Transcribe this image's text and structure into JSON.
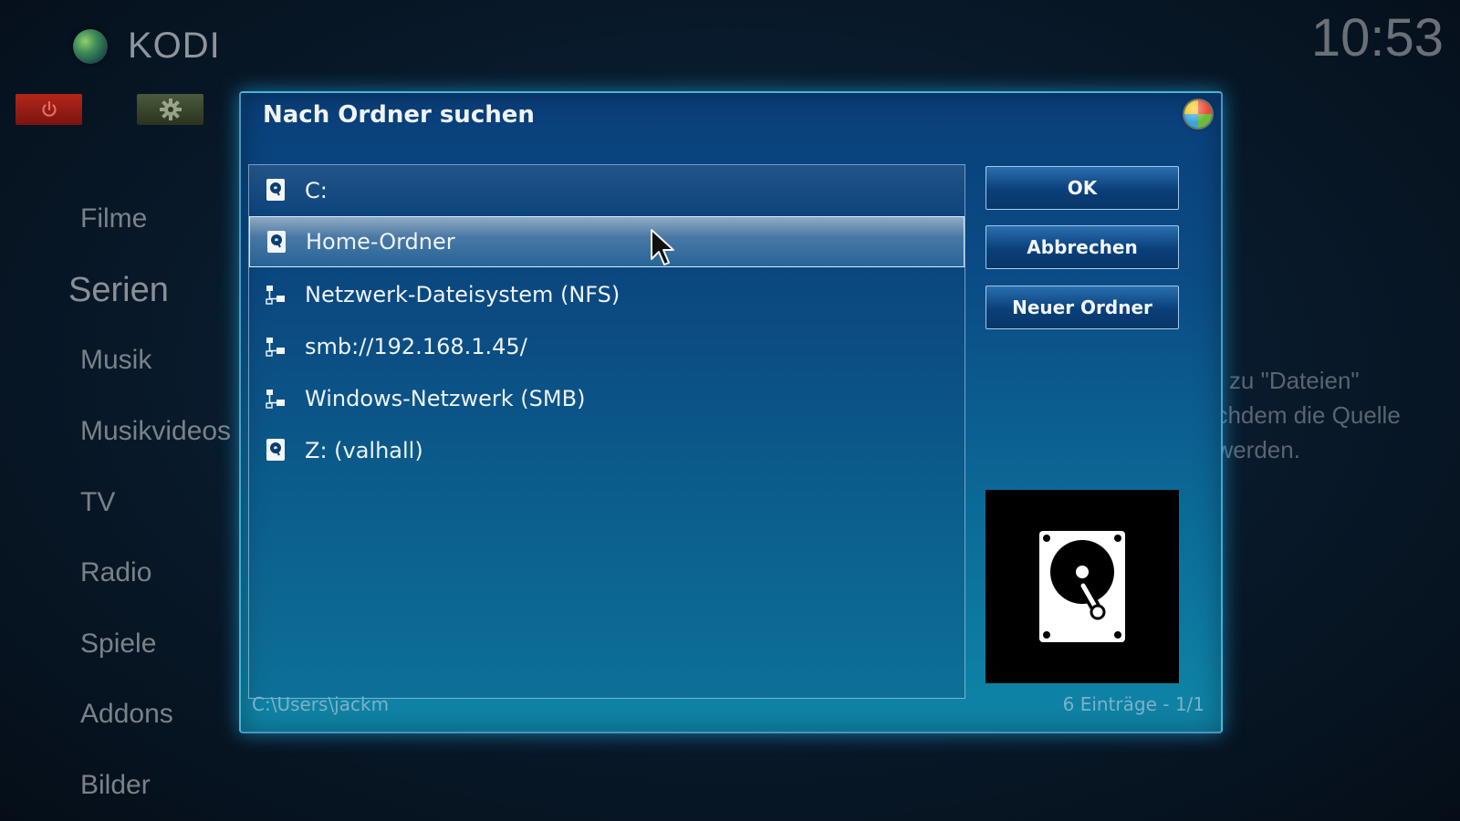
{
  "app": {
    "title": "KODI",
    "clock": "10:53"
  },
  "top_buttons": {
    "power_icon": "power-icon",
    "settings_icon": "gear-icon"
  },
  "sidebar": {
    "items": [
      {
        "label": "Filme"
      },
      {
        "label": "Serien"
      },
      {
        "label": "Musik"
      },
      {
        "label": "Musikvideos"
      },
      {
        "label": "TV"
      },
      {
        "label": "Radio"
      },
      {
        "label": "Spiele"
      },
      {
        "label": "Addons"
      },
      {
        "label": "Bilder"
      }
    ]
  },
  "background_hint": {
    "lines": [
      "n, zu \"Dateien\"",
      "achdem die Quelle",
      "t werden."
    ]
  },
  "dialog": {
    "title": "Nach Ordner suchen",
    "items": [
      {
        "label": "C:",
        "icon": "harddisk-icon"
      },
      {
        "label": "Home-Ordner",
        "icon": "harddisk-icon",
        "selected": true
      },
      {
        "label": "Netzwerk-Dateisystem (NFS)",
        "icon": "network-icon"
      },
      {
        "label": "smb://192.168.1.45/",
        "icon": "network-icon"
      },
      {
        "label": "Windows-Netzwerk (SMB)",
        "icon": "network-icon"
      },
      {
        "label": "Z: (valhall)",
        "icon": "harddisk-icon"
      }
    ],
    "buttons": {
      "ok": "OK",
      "cancel": "Abbrechen",
      "new_folder": "Neuer Ordner"
    },
    "path": "C:\\Users\\jackm",
    "count": "6 Einträge - 1/1",
    "preview_icon": "harddisk-icon"
  }
}
